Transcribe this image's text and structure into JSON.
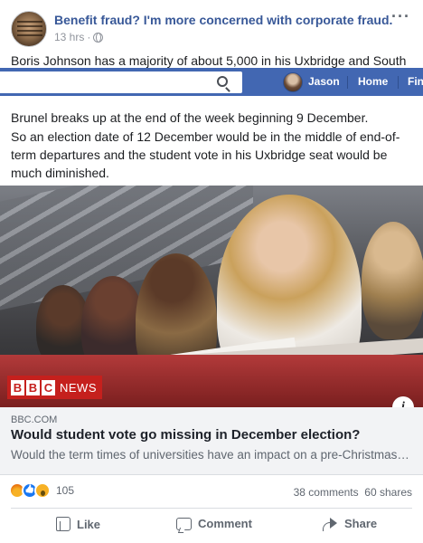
{
  "post": {
    "page_name": "Benefit fraud? I'm more concerned with corporate fraud.",
    "time": "13 hrs",
    "separator": "·",
    "more": "···",
    "text_line_1": "Boris Johnson has a majority of about 5,000 in his Uxbridge and South",
    "text_line_2": "Brunel breaks up at the end of the week beginning 9 December.",
    "text_para_2": "So an election date of 12 December would be in the middle of end-of-term departures and the student vote in his Uxbridge seat would be much diminished."
  },
  "top_bar": {
    "search_placeholder": "",
    "user_name": "Jason",
    "home": "Home",
    "find": "Fin",
    "color": "#4267b2"
  },
  "link": {
    "brand": "BBC",
    "brand_suffix": "NEWS",
    "info": "i",
    "domain": "BBC.COM",
    "title": "Would student vote go missing in December election?",
    "description": "Would the term times of universities have an impact on a pre-Christmas…"
  },
  "engagement": {
    "reactions": [
      "angry-icon",
      "like-icon",
      "wow-icon"
    ],
    "reaction_count": "105",
    "comments": "38 comments",
    "shares": "60 shares"
  },
  "actions": {
    "like": "Like",
    "comment": "Comment",
    "share": "Share"
  }
}
